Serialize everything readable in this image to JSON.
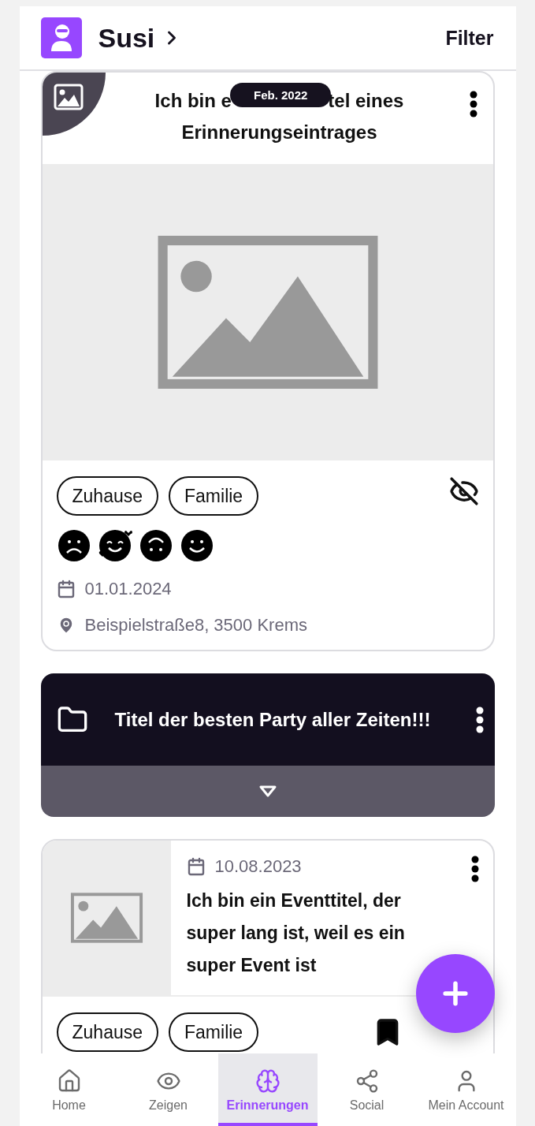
{
  "header": {
    "name": "Susi",
    "action": "Filter"
  },
  "memory": {
    "title_start": "Ich bin e",
    "title_end": "tel eines",
    "title_line2": "Erinnerungseintrages",
    "date_badge": "Feb. 2022",
    "tags": [
      "Zuhause",
      "Familie"
    ],
    "hidden": true,
    "moods": [
      {
        "kind": "sad"
      },
      {
        "kind": "love"
      },
      {
        "kind": "upside_down"
      },
      {
        "kind": "happy"
      }
    ],
    "date": "01.01.2024",
    "location": "Beispielstraße8, 3500 Krems"
  },
  "folder": {
    "title": "Titel der besten Party aller Zeiten!!!",
    "expanded": false
  },
  "event": {
    "date": "10.08.2023",
    "title": "Ich bin ein Eventtitel, der super lang ist, weil es ein super Event ist",
    "tags": [
      "Zuhause",
      "Familie"
    ],
    "bookmarked": true
  },
  "nav": [
    {
      "kind": "home",
      "label": "Home",
      "selected": false
    },
    {
      "kind": "eye",
      "label": "Zeigen",
      "selected": false
    },
    {
      "kind": "brain",
      "label": "Erinnerungen",
      "selected": true
    },
    {
      "kind": "social",
      "label": "Social",
      "selected": false
    },
    {
      "kind": "user",
      "label": "Mein Account",
      "selected": false
    }
  ]
}
